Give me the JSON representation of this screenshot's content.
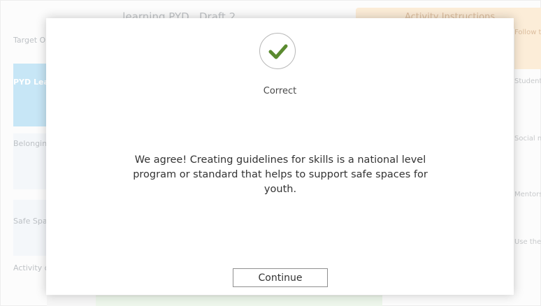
{
  "background": {
    "title": "...learning PYD...Draft 2...",
    "header_right": "Activity Instructions",
    "left_cells": {
      "target": "Target Outcome",
      "pyd": "PYD Learning",
      "belonging": "Belonging and Membership",
      "safe": "Safe Spaces",
      "activity": "Activity options do not"
    },
    "right_cells": [
      "Follow then follow",
      "Students create their stories to social relationships",
      "Social media drawing to meaning of youth",
      "Mentorship research areas",
      "Use these programs school radio station"
    ]
  },
  "modal": {
    "status": "Correct",
    "feedback": "We agree! Creating guidelines for skills is a national level program or standard that helps to support safe spaces for youth.",
    "continue_label": "Continue",
    "check_color": "#5a8a2f"
  }
}
